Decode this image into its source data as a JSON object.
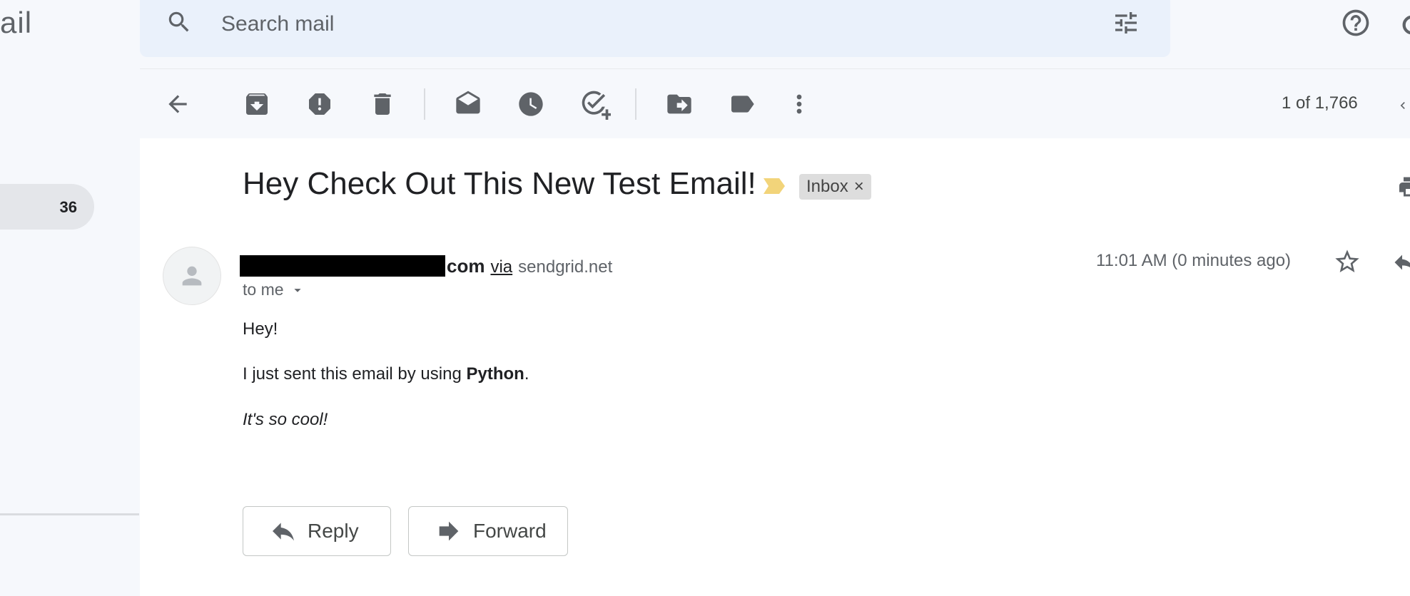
{
  "app": {
    "logo_fragment": "ail"
  },
  "search": {
    "placeholder": "Search mail"
  },
  "sidebar": {
    "selected_count": "36"
  },
  "toolbar": {
    "buttons": [
      "back-icon",
      "archive-icon",
      "report-spam-icon",
      "delete-icon",
      "mark-unread-icon",
      "snooze-icon",
      "add-task-icon",
      "move-to-icon",
      "labels-icon",
      "more-icon"
    ],
    "pager": "1 of 1,766"
  },
  "message": {
    "subject": "Hey Check Out This New Test Email!",
    "label_chip": "Inbox",
    "label_chip_close": "×",
    "sender_domain_visible": "com",
    "via_label": "via",
    "via_domain": "sendgrid.net",
    "recipient": "to me",
    "timestamp": "11:01 AM (0 minutes ago)",
    "body": {
      "line1": "Hey!",
      "line2_prefix": "I just sent this email by using ",
      "line2_bold": "Python",
      "line2_suffix": ".",
      "line3": "It's so cool!"
    }
  },
  "actions": {
    "reply": "Reply",
    "forward": "Forward"
  },
  "colors": {
    "background": "#f6f8fc",
    "search_bg": "#eaf1fb",
    "icon": "#5f6368",
    "importance_marker": "#f2d47a"
  }
}
